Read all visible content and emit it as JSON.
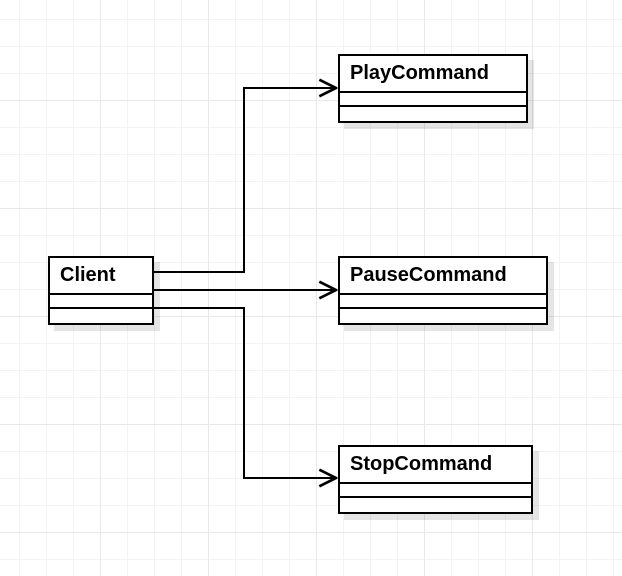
{
  "diagram": {
    "type": "uml-class",
    "classes": {
      "client": {
        "name": "Client"
      },
      "playCommand": {
        "name": "PlayCommand"
      },
      "pauseCommand": {
        "name": "PauseCommand"
      },
      "stopCommand": {
        "name": "StopCommand"
      }
    },
    "relations": [
      {
        "from": "client",
        "to": "playCommand",
        "kind": "association-arrow"
      },
      {
        "from": "client",
        "to": "pauseCommand",
        "kind": "association-arrow"
      },
      {
        "from": "client",
        "to": "stopCommand",
        "kind": "association-arrow"
      }
    ]
  }
}
